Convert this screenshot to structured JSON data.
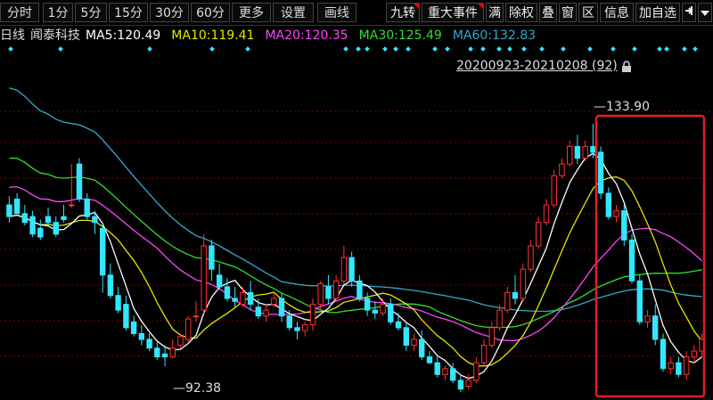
{
  "toolbar": {
    "left_buttons": [
      "分时",
      "1分",
      "5分",
      "15分",
      "30分",
      "60分",
      "更多",
      "设置",
      "画线"
    ],
    "right_buttons": [
      "九转",
      "重大事件",
      "满",
      "除权",
      "叠",
      "窗",
      "区",
      "信息",
      "加自选"
    ],
    "pin_icon": "pin-icon",
    "dropdown_icon": "dropdown-triangle-icon"
  },
  "info": {
    "period": "日线",
    "stock_name": "闻泰科技",
    "ma5_label": "MA5:",
    "ma5_value": "120.49",
    "ma10_label": "MA10:",
    "ma10_value": "119.41",
    "ma20_label": "MA20:",
    "ma20_value": "120.35",
    "ma30_label": "MA30:",
    "ma30_value": "125.49",
    "ma60_label": "MA60:",
    "ma60_value": "132.83"
  },
  "range": {
    "text": "20200923-20210208 (92)",
    "lock_icon": "lock-icon"
  },
  "high_label": "133.90",
  "low_label": "92.38",
  "colors": {
    "up": "#ff3333",
    "down": "#33e6ff",
    "ma5": "#ffffff",
    "ma10": "#e6e600",
    "ma20": "#ff44ff",
    "ma30": "#33dd33",
    "ma60": "#33aacc",
    "highlight": "#e02020",
    "grid": "#7a0000"
  },
  "chart_data": {
    "type": "candlestick",
    "high": 133.9,
    "low": 92.38,
    "candles": [
      [
        120,
        121.5,
        118,
        117
      ],
      [
        121,
        122,
        118.5,
        118.5
      ],
      [
        118.5,
        120,
        117,
        116.5
      ],
      [
        118,
        119,
        115,
        114.5
      ],
      [
        116,
        117.5,
        114.5,
        114
      ],
      [
        118,
        119.5,
        117,
        116.5
      ],
      [
        117,
        118,
        115,
        114.5
      ],
      [
        118,
        120,
        117.5,
        117
      ],
      [
        120,
        127,
        120,
        119.5
      ],
      [
        127,
        128,
        121,
        120.5
      ],
      [
        121,
        122,
        118,
        117.5
      ],
      [
        118,
        119,
        117,
        115
      ],
      [
        116,
        117,
        108,
        105
      ],
      [
        108,
        110,
        104.5,
        104
      ],
      [
        104.5,
        106,
        102,
        101.5
      ],
      [
        103,
        104.5,
        99,
        98.5
      ],
      [
        100,
        101,
        98,
        97.5
      ],
      [
        98,
        99.5,
        97,
        96
      ],
      [
        97,
        98,
        95.5,
        95
      ],
      [
        95.5,
        96.5,
        94,
        93.5
      ],
      [
        94.5,
        96,
        94,
        92.38
      ],
      [
        94,
        97,
        95.5,
        93.8
      ],
      [
        96,
        98,
        97.5,
        95.5
      ],
      [
        97,
        101,
        100.5,
        96.5
      ],
      [
        101,
        103.5,
        101,
        100
      ],
      [
        102,
        115,
        113,
        101.5
      ],
      [
        113,
        114,
        109,
        107
      ],
      [
        108,
        110,
        106,
        105.5
      ],
      [
        106,
        107.5,
        104,
        103.5
      ],
      [
        104,
        106,
        103.5,
        102.5
      ],
      [
        103,
        106,
        105,
        102.5
      ],
      [
        105,
        107,
        103,
        102
      ],
      [
        102.5,
        104,
        101,
        100.5
      ],
      [
        101,
        103,
        102,
        100
      ],
      [
        103,
        105,
        104,
        102.5
      ],
      [
        104,
        105,
        101,
        100
      ],
      [
        101,
        102,
        99,
        98.5
      ],
      [
        99,
        100,
        98.5,
        97
      ],
      [
        98.5,
        100,
        99.5,
        97.5
      ],
      [
        99.5,
        104,
        103,
        98.5
      ],
      [
        103,
        107,
        106.5,
        102
      ],
      [
        106,
        108,
        104,
        103
      ],
      [
        104,
        108,
        107,
        103.5
      ],
      [
        107,
        113,
        111,
        106.5
      ],
      [
        111,
        112,
        107,
        106
      ],
      [
        107,
        108,
        104,
        103.5
      ],
      [
        104,
        105,
        102,
        101
      ],
      [
        102,
        103.5,
        101.5,
        100.5
      ],
      [
        101.5,
        104,
        103,
        101
      ],
      [
        103,
        104,
        100,
        99.5
      ],
      [
        100,
        101.5,
        99,
        98.5
      ],
      [
        99,
        100,
        96,
        95
      ],
      [
        96,
        98,
        97,
        95
      ],
      [
        97,
        98.5,
        94,
        93.5
      ],
      [
        94,
        95,
        93,
        92.8
      ],
      [
        93,
        94,
        91,
        90.5
      ],
      [
        91,
        92.5,
        92,
        90
      ],
      [
        92,
        93,
        90,
        89.5
      ],
      [
        90,
        91,
        88.5,
        88
      ],
      [
        89,
        91,
        90,
        88.5
      ],
      [
        90,
        94,
        93,
        89.5
      ],
      [
        93,
        97,
        96,
        92.5
      ],
      [
        96,
        100,
        99,
        95.5
      ],
      [
        99,
        103,
        102,
        98.5
      ],
      [
        102,
        106,
        105,
        101.5
      ],
      [
        105,
        108,
        104,
        103
      ],
      [
        104,
        110,
        109,
        103.5
      ],
      [
        109,
        114,
        113,
        108.5
      ],
      [
        113,
        118,
        117,
        112.5
      ],
      [
        117,
        121,
        120,
        116.5
      ],
      [
        120,
        126,
        125,
        119.5
      ],
      [
        125,
        128,
        127,
        124.5
      ],
      [
        127,
        131,
        130,
        126.5
      ],
      [
        130,
        132,
        128,
        127
      ],
      [
        128,
        131,
        130,
        127.5
      ],
      [
        130,
        133.9,
        129,
        128
      ],
      [
        129,
        130,
        122,
        121
      ],
      [
        122,
        123,
        118,
        117.5
      ],
      [
        118,
        120,
        119,
        117
      ],
      [
        119,
        120,
        114,
        113
      ],
      [
        114,
        115,
        107,
        106.5
      ],
      [
        107,
        108,
        100,
        99.5
      ],
      [
        100,
        102,
        101,
        99
      ],
      [
        101,
        103,
        97,
        96
      ],
      [
        97,
        98,
        92,
        91.5
      ],
      [
        92,
        94,
        93,
        91
      ],
      [
        93,
        94,
        91,
        90.5
      ],
      [
        91,
        95,
        94,
        90
      ],
      [
        94,
        96,
        95,
        93
      ],
      [
        95,
        98,
        97,
        94
      ]
    ]
  }
}
